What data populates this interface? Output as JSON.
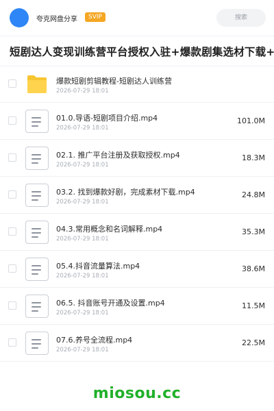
{
  "header": {
    "sharer_name": "夸克网盘分享",
    "badge": "SVIP",
    "search_label": "搜索",
    "avatar_color": "#2f86f6",
    "badge_color": "#f5a623"
  },
  "share": {
    "title": "短剧达人变现训练营平台授权入驻+爆款剧集选材下载+账号"
  },
  "files": [
    {
      "type": "folder",
      "icon": "folder-icon",
      "name": "爆款短剧剪辑教程-短剧达人训练营",
      "date": "2026-07-29 18:01",
      "size": ""
    },
    {
      "type": "video",
      "icon": "document-icon",
      "name": "01.0.导语-短剧项目介绍.mp4",
      "date": "2026-07-29 18:01",
      "size": "101.0M"
    },
    {
      "type": "video",
      "icon": "document-icon",
      "name": "02.1. 推广平台注册及获取授权.mp4",
      "date": "2026-07-29 18:01",
      "size": "18.3M"
    },
    {
      "type": "video",
      "icon": "document-icon",
      "name": "03.2. 找到爆款好剧，完成素材下载.mp4",
      "date": "2026-07-29 18:01",
      "size": "24.8M"
    },
    {
      "type": "video",
      "icon": "document-icon",
      "name": "04.3.常用概念和名词解释.mp4",
      "date": "2026-07-29 18:01",
      "size": "35.3M"
    },
    {
      "type": "video",
      "icon": "document-icon",
      "name": "05.4.抖音流量算法.mp4",
      "date": "2026-07-29 18:01",
      "size": "38.6M"
    },
    {
      "type": "video",
      "icon": "document-icon",
      "name": "06.5. 抖音账号开通及设置.mp4",
      "date": "2026-07-29 18:01",
      "size": "11.5M"
    },
    {
      "type": "video",
      "icon": "document-icon",
      "name": "07.6.养号全流程.mp4",
      "date": "2026-07-29 18:01",
      "size": "22.5M"
    }
  ],
  "watermark": "miosou.cc",
  "colors": {
    "folder": "#f7c531",
    "watermark": "#21b02a"
  }
}
